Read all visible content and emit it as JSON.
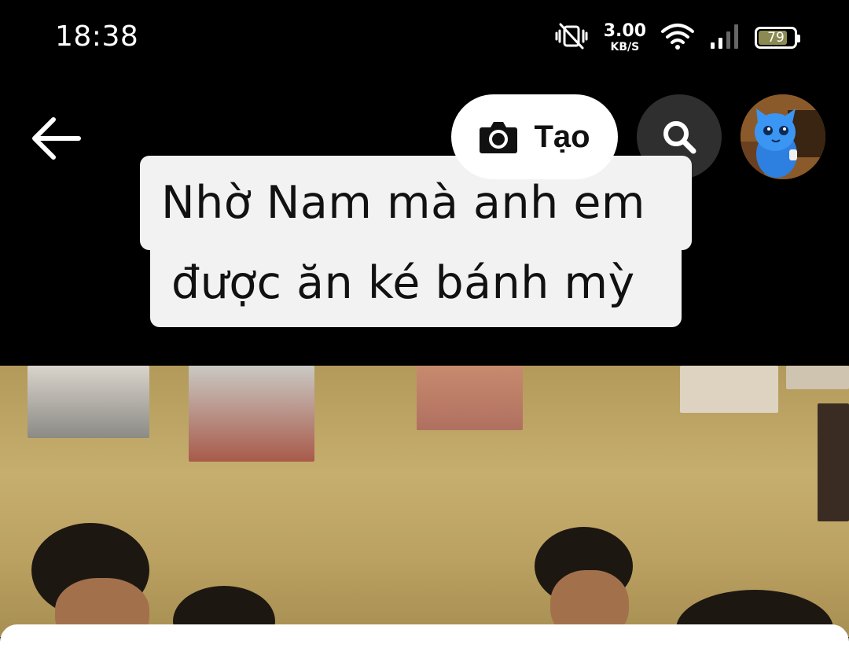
{
  "status_bar": {
    "time": "18:38",
    "net_speed_value": "3.00",
    "net_speed_unit": "KB/S",
    "battery_level": "79",
    "icons": [
      "vibrate-mute-icon",
      "wifi-icon",
      "signal-icon",
      "battery-icon"
    ]
  },
  "nav": {
    "back_icon": "arrow-left-icon",
    "create_label": "Tạo",
    "create_icon": "camera-icon",
    "search_icon": "search-icon",
    "avatar": "profile-avatar-blue-cat"
  },
  "caption": {
    "line1": "Nhờ Nam mà anh em",
    "line2": "được ăn ké bánh mỳ"
  },
  "colors": {
    "background": "#000000",
    "caption_bg": "#f2f2f2",
    "create_button_bg": "#ffffff",
    "search_button_bg": "#2f2f2f"
  }
}
